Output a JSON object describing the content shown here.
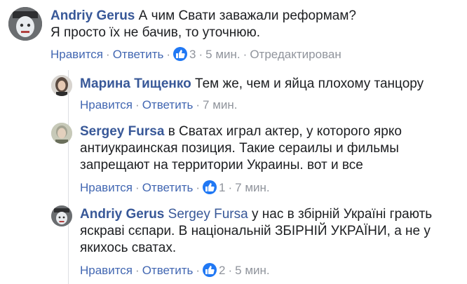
{
  "comments": [
    {
      "author": "Andriy Gerus",
      "mention": "",
      "line1": "А чим Свати заважали реформам?",
      "line2": "Я просто їх не бачив, то уточнюю.",
      "like_label": "Нравится",
      "reply_label": "Ответить",
      "likes": "3",
      "time": "5 мин.",
      "edited": "Отредактирован",
      "avatar_icon": "user-avatar-icon"
    },
    {
      "author": "Марина Тищенко",
      "text": "Тем же, чем и яйца плохому танцору",
      "like_label": "Нравится",
      "reply_label": "Ответить",
      "time": "7 мин.",
      "avatar_icon": "user-avatar-icon"
    },
    {
      "author": "Sergey Fursa",
      "line1": "в Сватах играл актер, у которого ярко",
      "line2": "антиукраинская позиция. Такие сераилы и фильмы",
      "line3": "запрещают на территории Украины. вот и все",
      "like_label": "Нравится",
      "reply_label": "Ответить",
      "likes": "1",
      "time": "7 мин.",
      "avatar_icon": "user-avatar-icon"
    },
    {
      "author": "Andriy Gerus",
      "mention": "Sergey Fursa",
      "line1": "у нас в збірній Україні грають",
      "line2": "яскраві сєпари. В національній ЗБІРНІЙ УКРАЇНИ, а не у",
      "line3": "якихось сватах.",
      "like_label": "Нравится",
      "reply_label": "Ответить",
      "likes": "2",
      "time": "5 мин.",
      "avatar_icon": "user-avatar-icon"
    }
  ],
  "colors": {
    "link": "#385898",
    "action": "#4267b2",
    "meta": "#90949c",
    "like_badge": "#2078f4"
  }
}
